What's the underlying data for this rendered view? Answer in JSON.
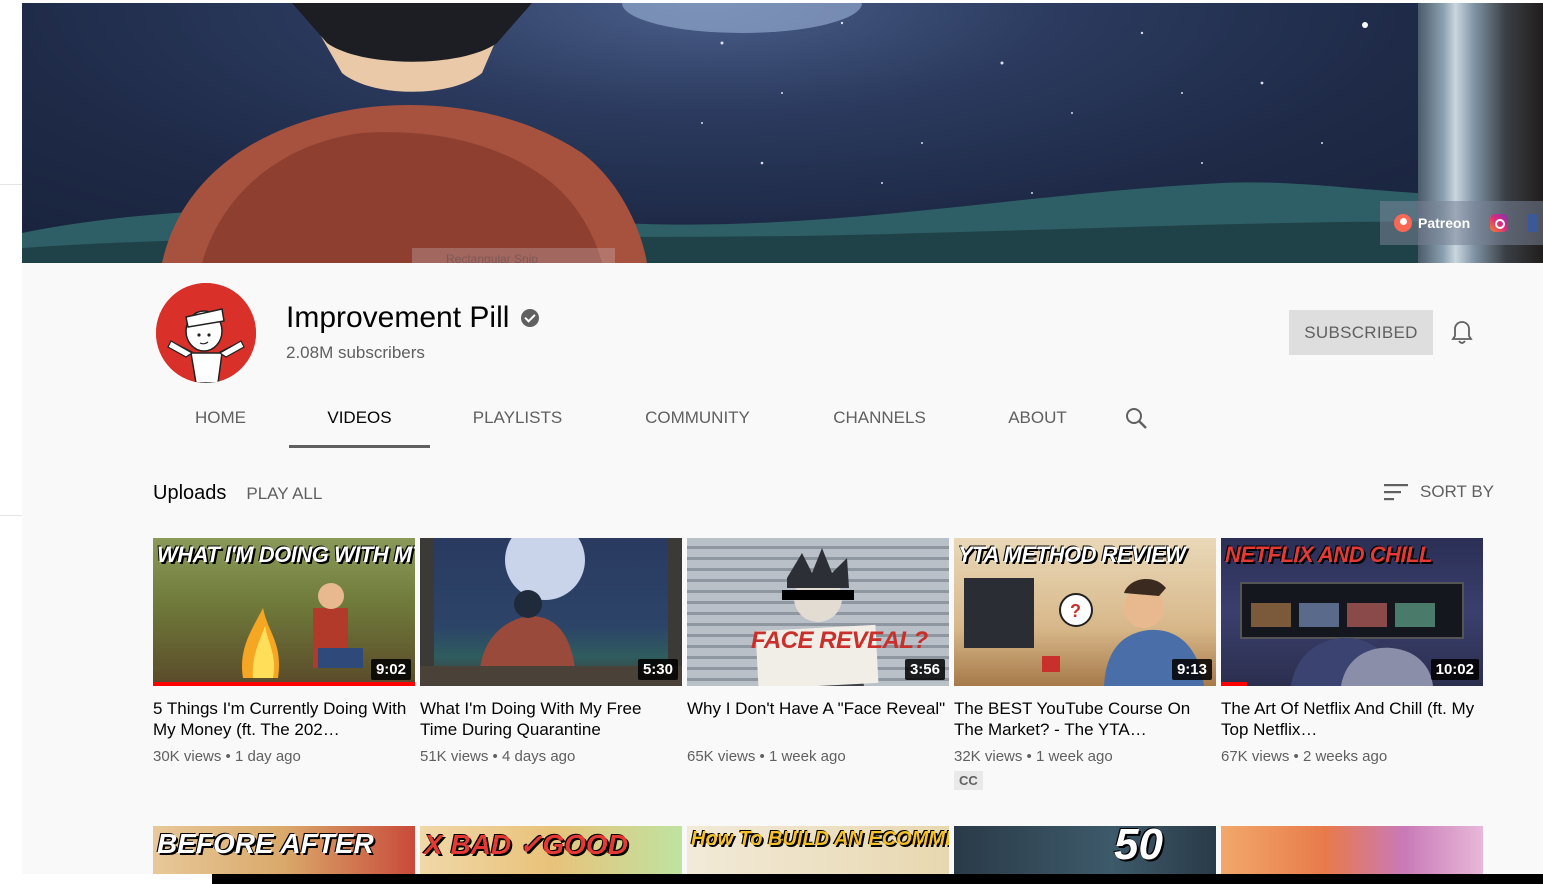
{
  "banner": {
    "links": [
      {
        "label": "Patreon",
        "icon": "patreon-icon"
      },
      {
        "label": "",
        "icon": "instagram-icon"
      },
      {
        "label": "",
        "icon": "facebook-icon"
      }
    ],
    "faint_label": "Rectangular Snip"
  },
  "channel": {
    "name": "Improvement Pill",
    "subscribers": "2.08M subscribers",
    "subscribe_label": "SUBSCRIBED"
  },
  "tabs": [
    {
      "label": "HOME"
    },
    {
      "label": "VIDEOS"
    },
    {
      "label": "PLAYLISTS"
    },
    {
      "label": "COMMUNITY"
    },
    {
      "label": "CHANNELS"
    },
    {
      "label": "ABOUT"
    }
  ],
  "uploads": {
    "title": "Uploads",
    "play_all": "PLAY ALL",
    "sort_by": "SORT BY"
  },
  "videos": [
    {
      "thumb_text": "WHAT I'M DOING WITH MY MONEY",
      "duration": "9:02",
      "progress": 1.0,
      "title": "5 Things I'm Currently Doing With My Money (ft. The 202…",
      "views": "30K views",
      "age": "1 day ago",
      "cc": ""
    },
    {
      "thumb_text": "",
      "duration": "5:30",
      "progress": 0,
      "title": "What I'm Doing With My Free Time During Quarantine",
      "views": "51K views",
      "age": "4 days ago",
      "cc": ""
    },
    {
      "thumb_text": "FACE REVEAL?",
      "duration": "3:56",
      "progress": 0,
      "title": "Why I Don't Have A \"Face Reveal\"",
      "views": "65K views",
      "age": "1 week ago",
      "cc": ""
    },
    {
      "thumb_text": "YTA METHOD REVIEW",
      "duration": "9:13",
      "progress": 0,
      "title": "The BEST YouTube Course On The Market? - The YTA…",
      "views": "32K views",
      "age": "1 week ago",
      "cc": "CC"
    },
    {
      "thumb_text": "NETFLIX AND CHILL",
      "duration": "10:02",
      "progress": 0.1,
      "title": "The Art Of Netflix And Chill (ft. My Top Netflix…",
      "views": "67K views",
      "age": "2 weeks ago",
      "cc": ""
    }
  ],
  "videos_row2": [
    {
      "thumb_text": "BEFORE  AFTER"
    },
    {
      "thumb_text": "X BAD  ✓GOOD"
    },
    {
      "thumb_text": "How To BUILD AN ECOMMERCE WEBSITE"
    },
    {
      "thumb_text": "50"
    },
    {
      "thumb_text": ""
    }
  ],
  "colors": {
    "accent_red": "#ff0000",
    "text_secondary": "#606060",
    "background": "#f9f9f9"
  }
}
